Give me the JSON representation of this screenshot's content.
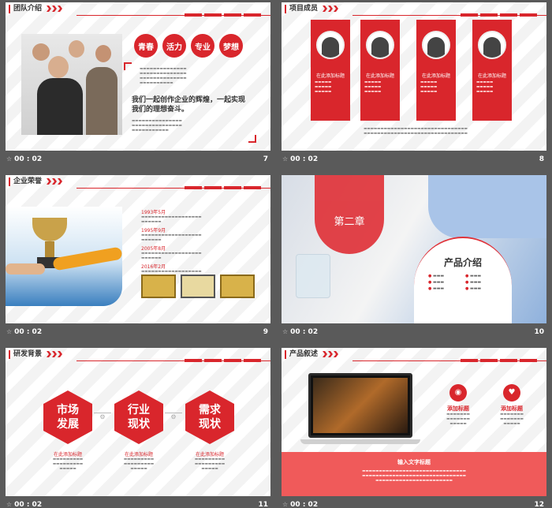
{
  "slides": [
    {
      "title": "团队介绍",
      "page": "7",
      "time": "00 : 02",
      "tags": [
        "青春",
        "活力",
        "专业",
        "梦想"
      ],
      "headline": "我们一起创作企业的辉煌，一起实现我们的理想奋斗。"
    },
    {
      "title": "项目成员",
      "page": "8",
      "time": "00 : 02",
      "member_title": "在此添加标题"
    },
    {
      "title": "企业荣誉",
      "page": "9",
      "time": "00 : 02",
      "years": [
        "1993年5月",
        "1995年9月",
        "2005年8月",
        "2016年2月"
      ]
    },
    {
      "title": "第二章",
      "page": "10",
      "time": "00 : 02",
      "product_title": "产品介绍"
    },
    {
      "title": "研发背景",
      "page": "11",
      "time": "00 : 02",
      "hex": [
        "市场发展",
        "行业现状",
        "需求现状"
      ],
      "hex_caption": "在此添加标题"
    },
    {
      "title": "产品叙述",
      "page": "12",
      "time": "00 : 02",
      "feature_title": "添加标题",
      "banner_title": "输入文字标题"
    }
  ]
}
